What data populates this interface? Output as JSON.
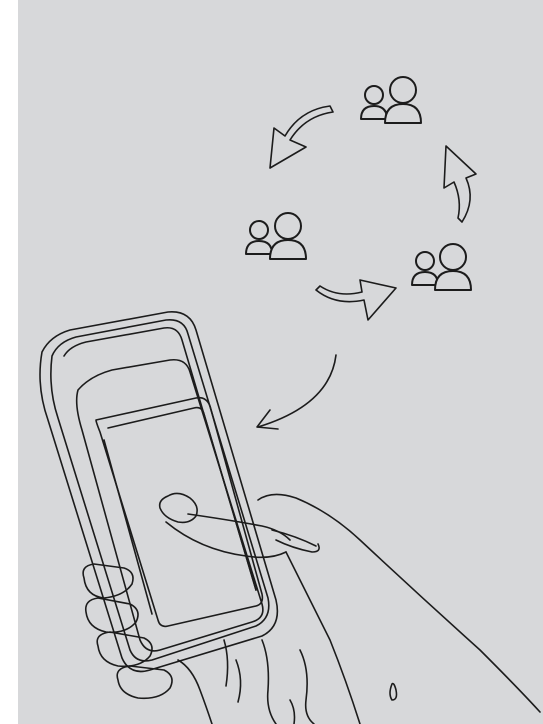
{
  "illustration": {
    "background_color": "#d7d8da",
    "margin_color": "#ffffff",
    "line_color": "#1c1c1c",
    "icons": [
      "people-group-icon",
      "people-group-icon",
      "people-group-icon",
      "curved-arrow-icon",
      "curved-arrow-icon",
      "curved-arrow-icon",
      "curved-arrow-icon"
    ]
  }
}
